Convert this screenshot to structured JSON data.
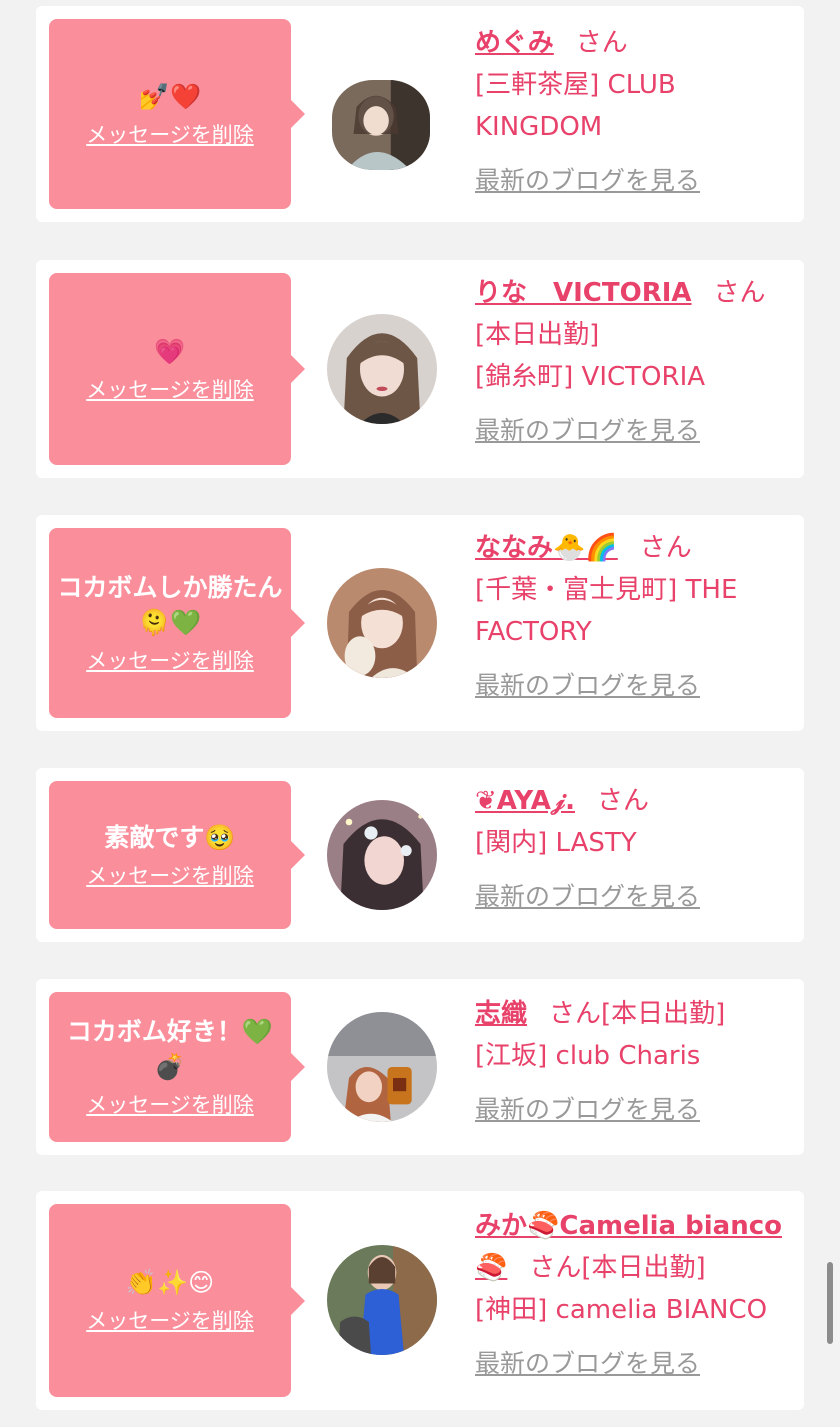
{
  "delete_label": "メッセージを削除",
  "san_label": "さん",
  "blog_label": "最新のブログを見る",
  "colors": {
    "accent": "#e8416a",
    "bubble": "#fb8e9b",
    "background": "#f2f2f2"
  },
  "cards": [
    {
      "message": "💅❤️",
      "name": "めぐみ",
      "extra": "",
      "shop_lines": [
        "[三軒茶屋] CLUB KINGDOM"
      ]
    },
    {
      "message": "💗",
      "name": "りな　VICTORIA",
      "extra": "",
      "shop_lines": [
        "[本日出勤]",
        "[錦糸町] VICTORIA"
      ]
    },
    {
      "message": "コカボムしか勝たん🫠💚",
      "name": "ななみ🐣🌈",
      "extra": "",
      "shop_lines": [
        "[千葉・富士見町] THE FACTORY"
      ]
    },
    {
      "message": "素敵です🥹",
      "name": "❦AYA𝒿.",
      "extra": "",
      "shop_lines": [
        "[関内] LASTY"
      ]
    },
    {
      "message": "コカボム好き！💚💣",
      "name": "志織",
      "extra": "[本日出勤]",
      "shop_lines": [
        "[江坂] club Charis"
      ]
    },
    {
      "message": "👏✨😊",
      "name": "みか🍣Camelia bianco🍣",
      "extra": "[本日出勤]",
      "shop_lines": [
        "[神田] camelia BIANCO"
      ]
    }
  ]
}
